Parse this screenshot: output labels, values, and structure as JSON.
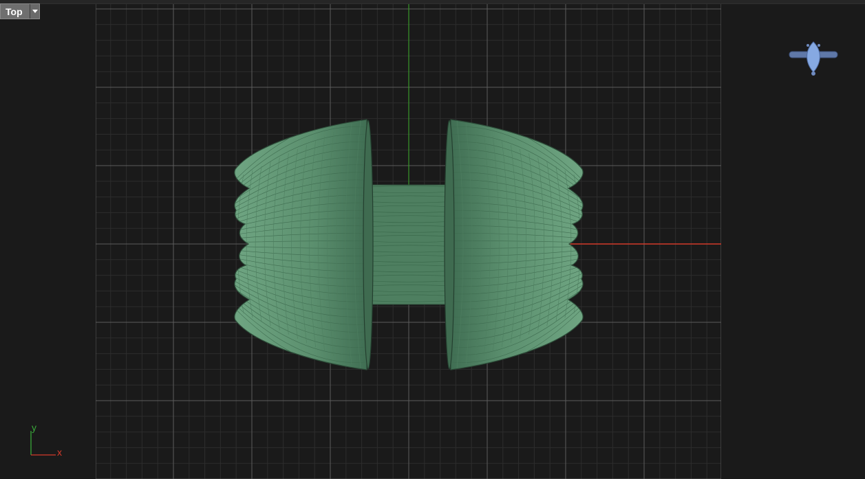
{
  "viewport": {
    "name": "Top"
  },
  "axes": {
    "x_label": "x",
    "y_label": "y"
  },
  "colors": {
    "background": "#1a1a1a",
    "grid_minor": "#2e2e2e",
    "grid_major": "#606060",
    "x_axis": "#d33a2a",
    "y_axis": "#3aa02a",
    "object_fill": "#5f9574",
    "object_edge": "#2c4b38",
    "gizmo": "#7ea0d8"
  },
  "icons": {
    "view_menu": "chevron-down-icon",
    "nav_gizmo": "ring-preview-icon"
  }
}
